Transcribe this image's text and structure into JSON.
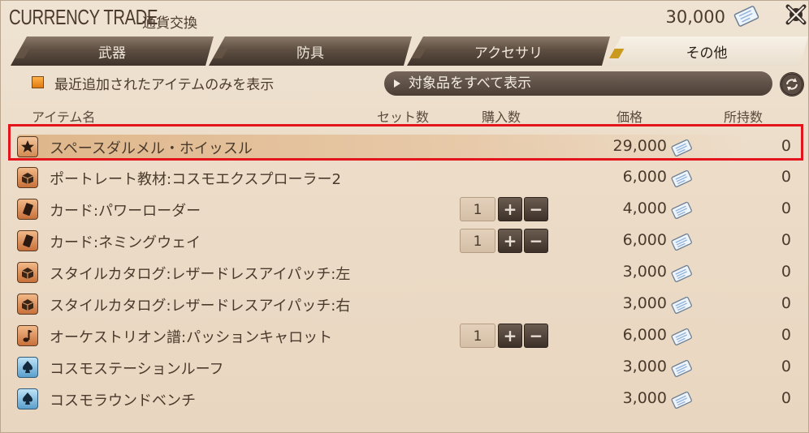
{
  "window": {
    "title": "CURRENCY TRADE",
    "subtitle": "通貨交換",
    "currency_amount": "30,000",
    "currency_icon": "poetics-ticket-icon",
    "close_icon": "close-icon"
  },
  "tabs": [
    {
      "label": "武器",
      "active": false
    },
    {
      "label": "防具",
      "active": false
    },
    {
      "label": "アクセサリ",
      "active": false
    },
    {
      "label": "その他",
      "active": true
    }
  ],
  "filter": {
    "checkbox_label": "最近追加されたアイテムのみを表示",
    "checked": true,
    "show_all_label": "対象品をすべて表示"
  },
  "columns": {
    "item_name": "アイテム名",
    "set_count": "セット数",
    "purchase_qty": "購入数",
    "price": "価格",
    "owned": "所持数"
  },
  "items": [
    {
      "icon": "star-icon",
      "name": "スペースダルメル・ホイッスル",
      "price": "29,000",
      "owned": "0",
      "qty": null,
      "selected": true
    },
    {
      "icon": "chest-icon",
      "name": "ポートレート教材:コスモエクスプローラー2",
      "price": "6,000",
      "owned": "0",
      "qty": null,
      "selected": false
    },
    {
      "icon": "card-icon",
      "name": "カード:パワーローダー",
      "price": "4,000",
      "owned": "0",
      "qty": "1",
      "selected": false
    },
    {
      "icon": "card-icon",
      "name": "カード:ネミングウェイ",
      "price": "6,000",
      "owned": "0",
      "qty": "1",
      "selected": false
    },
    {
      "icon": "chest-icon",
      "name": "スタイルカタログ:レザードレスアイパッチ:左",
      "price": "3,000",
      "owned": "0",
      "qty": null,
      "selected": false
    },
    {
      "icon": "chest-icon",
      "name": "スタイルカタログ:レザードレスアイパッチ:右",
      "price": "3,000",
      "owned": "0",
      "qty": null,
      "selected": false
    },
    {
      "icon": "music-note-icon",
      "name": "オーケストリオン譜:パッションキャロット",
      "price": "6,000",
      "owned": "0",
      "qty": "1",
      "selected": false
    },
    {
      "icon": "housing-spade-icon",
      "name": "コスモステーションルーフ",
      "price": "3,000",
      "owned": "0",
      "qty": null,
      "selected": false
    },
    {
      "icon": "housing-spade-icon",
      "name": "コスモラウンドベンチ",
      "price": "3,000",
      "owned": "0",
      "qty": null,
      "selected": false
    }
  ],
  "qty_controls": {
    "plus": "+",
    "minus": "−"
  }
}
